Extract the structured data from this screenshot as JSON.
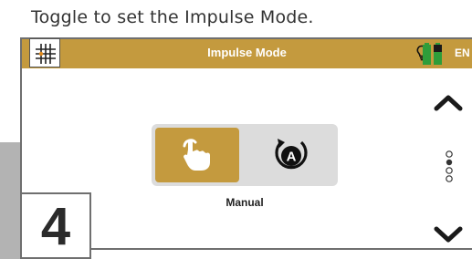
{
  "caption": "Toggle to set the Impulse Mode.",
  "header": {
    "title": "Impulse Mode",
    "language": "EN",
    "bg_color": "#c49a3e"
  },
  "icons": {
    "grid": "grid-icon",
    "bulb": "lightbulb-icon",
    "battery": "battery-icon",
    "manual": "hand-tap-icon",
    "auto": "auto-mode-icon",
    "up": "chevron-up-icon",
    "down": "chevron-down-icon",
    "more": "more-dots-icon"
  },
  "toggle": {
    "selected": "manual",
    "selected_label": "Manual"
  },
  "step_number": "4",
  "colors": {
    "accent": "#c49a3e",
    "battery_green": "#2e9d3a"
  }
}
